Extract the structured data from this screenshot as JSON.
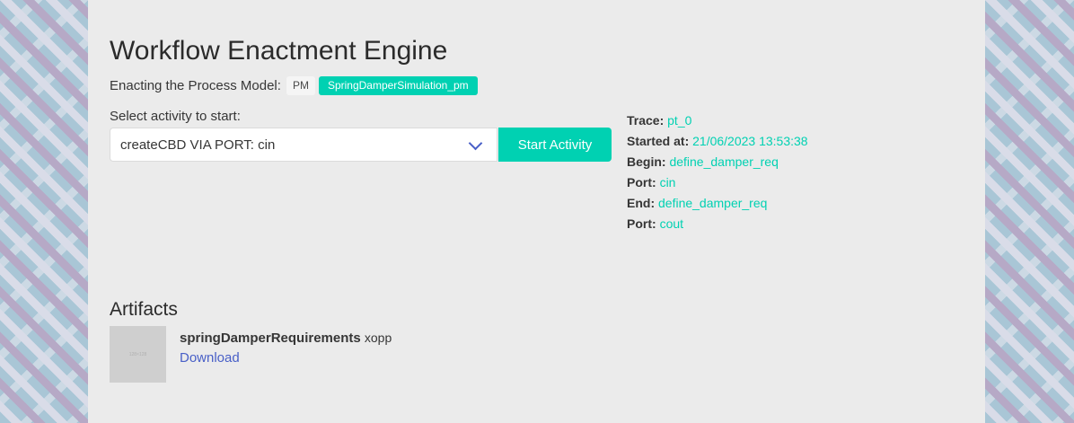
{
  "header": {
    "title": "Workflow Enactment Engine",
    "subtitle_label": "Enacting the Process Model:",
    "pm_tag": "PM",
    "model_name": "SpringDamperSimulation_pm"
  },
  "activity": {
    "label": "Select activity to start:",
    "selected": "createCBD VIA PORT: cin",
    "start_button": "Start Activity"
  },
  "trace": {
    "rows": [
      {
        "key": "Trace:",
        "value": "pt_0"
      },
      {
        "key": "Started at:",
        "value": "21/06/2023 13:53:38"
      },
      {
        "key": "Begin:",
        "value": "define_damper_req"
      },
      {
        "key": "Port:",
        "value": "cin"
      },
      {
        "key": "End:",
        "value": "define_damper_req"
      },
      {
        "key": "Port:",
        "value": "cout"
      }
    ]
  },
  "artifacts": {
    "title": "Artifacts",
    "items": [
      {
        "thumbnail_text": "128×128",
        "name": "springDamperRequirements",
        "type": "xopp",
        "download_label": "Download"
      }
    ]
  },
  "colors": {
    "accent": "#00d1b2",
    "link": "#485fc7",
    "background": "#ebebeb"
  }
}
